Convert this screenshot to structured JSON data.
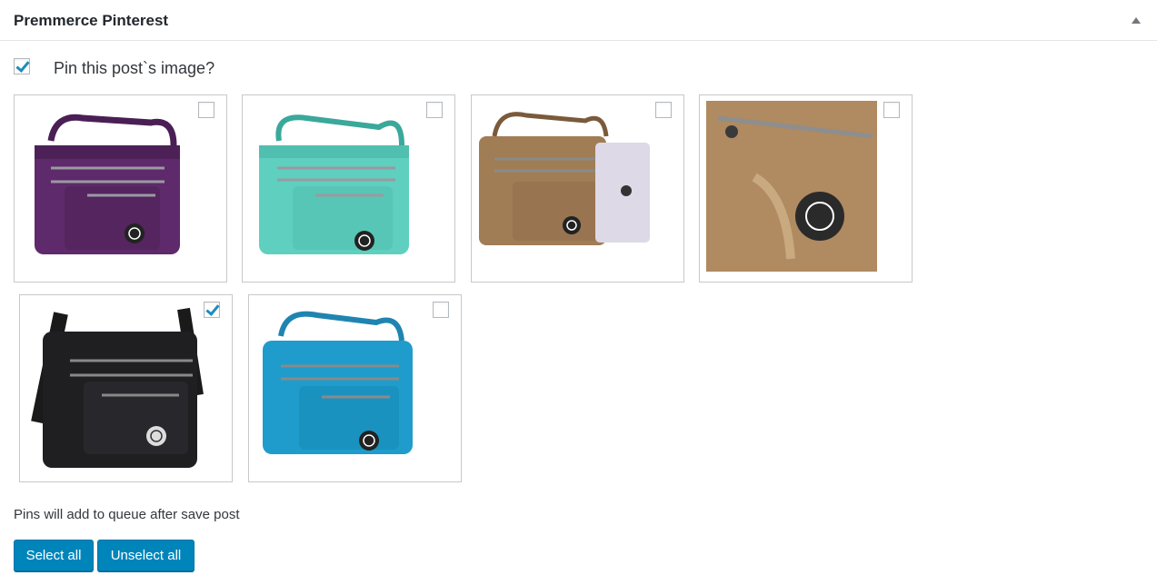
{
  "panel": {
    "title": "Premmerce Pinterest"
  },
  "pin_option": {
    "label": "Pin this post`s image?",
    "checked": true
  },
  "images": [
    {
      "name": "purple bag",
      "color": "#5e2a6b",
      "checked": false
    },
    {
      "name": "mint bag",
      "color": "#5fcfbf",
      "checked": false
    },
    {
      "name": "tan bag with tablet",
      "color": "#a07d55",
      "checked": false
    },
    {
      "name": "tan bag close-up",
      "color": "#b08a60",
      "checked": false
    },
    {
      "name": "black bag",
      "color": "#1f1f22",
      "checked": true
    },
    {
      "name": "blue bag",
      "color": "#1f9ccb",
      "checked": false
    }
  ],
  "note": "Pins will add to queue after save post",
  "buttons": {
    "select_all": "Select all",
    "unselect_all": "Unselect all"
  },
  "colors": {
    "primary_button": "#0085ba",
    "check_mark": "#1e8cbe"
  }
}
